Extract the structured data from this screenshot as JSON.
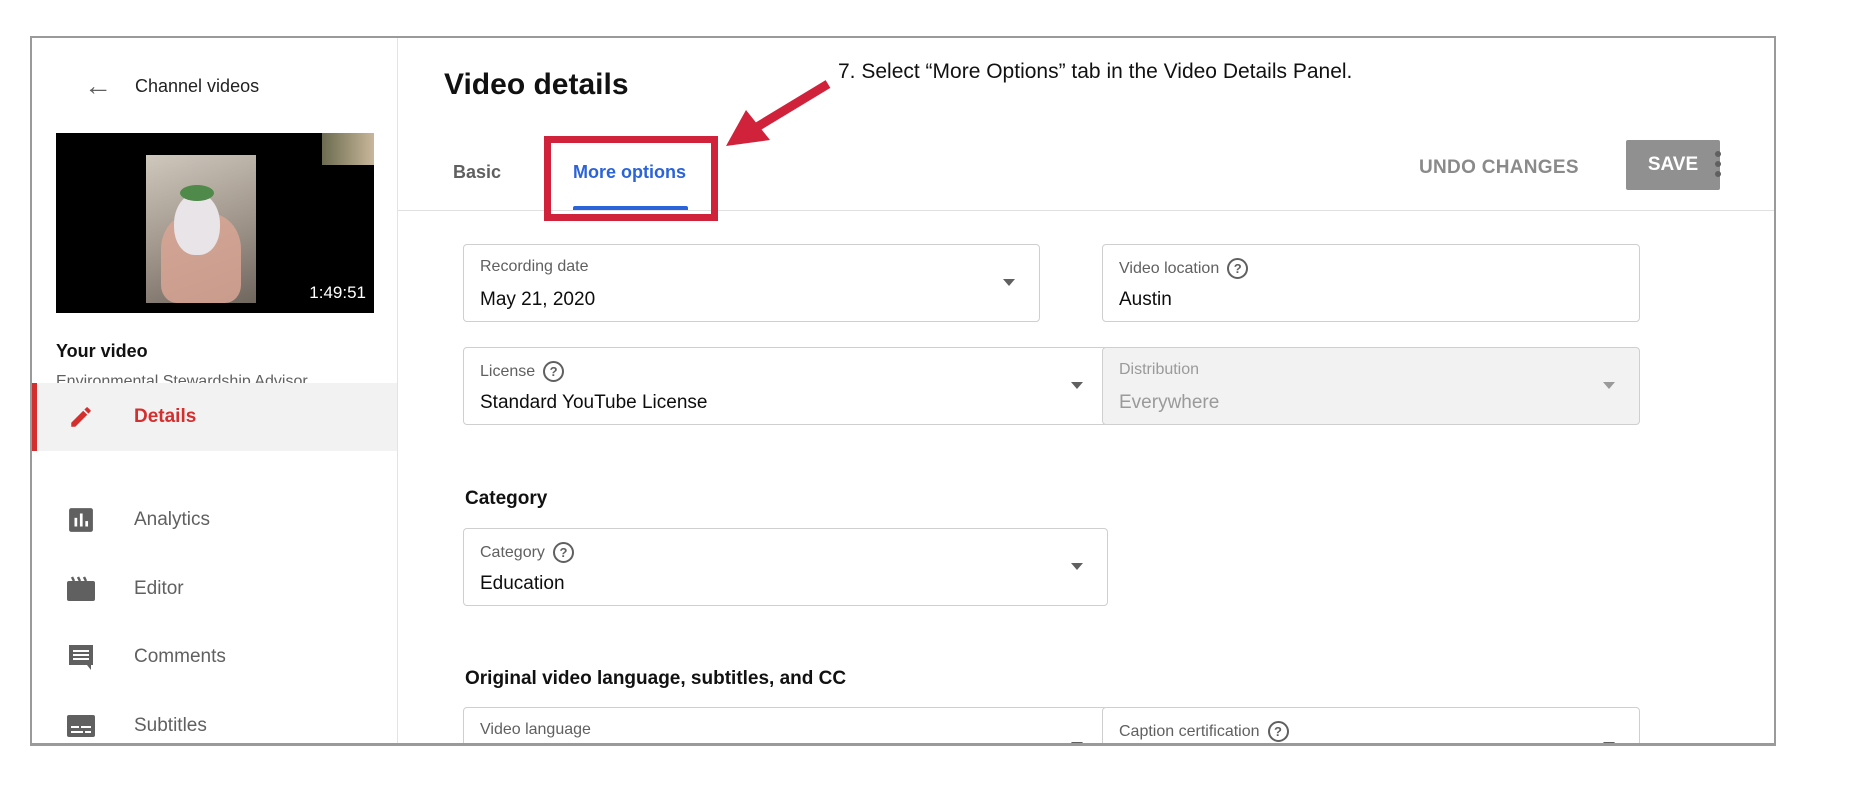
{
  "annotation": {
    "text": "7. Select “More Options” tab in the Video Details Panel.",
    "highlight_color": "#d0233b"
  },
  "sidebar": {
    "back_label": "Channel videos",
    "thumbnail": {
      "duration": "1:49:51"
    },
    "your_video_label": "Your video",
    "video_title": "Environmental Stewardship Advisor...",
    "items": [
      {
        "label": "Details",
        "icon": "pencil-icon",
        "active": true
      },
      {
        "label": "Analytics",
        "icon": "analytics-icon"
      },
      {
        "label": "Editor",
        "icon": "clapperboard-icon"
      },
      {
        "label": "Comments",
        "icon": "comment-icon"
      },
      {
        "label": "Subtitles",
        "icon": "subtitles-icon"
      }
    ],
    "accent": "#d32f2f"
  },
  "main": {
    "title": "Video details",
    "tabs": [
      {
        "label": "Basic"
      },
      {
        "label": "More options",
        "active": true
      }
    ],
    "undo_label": "UNDO CHANGES",
    "save_label": "SAVE",
    "tab_accent": "#2b63d9",
    "fields": {
      "recording_date": {
        "label": "Recording date",
        "value": "May 21, 2020"
      },
      "video_location": {
        "label": "Video location",
        "value": "Austin"
      },
      "license": {
        "label": "License",
        "value": "Standard YouTube License"
      },
      "distribution": {
        "label": "Distribution",
        "value": "Everywhere",
        "disabled": true
      },
      "category": {
        "label": "Category",
        "value": "Education"
      },
      "video_language": {
        "label": "Video language"
      },
      "caption_certification": {
        "label": "Caption certification"
      }
    },
    "sections": {
      "category": "Category",
      "language": "Original video language, subtitles, and CC"
    }
  }
}
